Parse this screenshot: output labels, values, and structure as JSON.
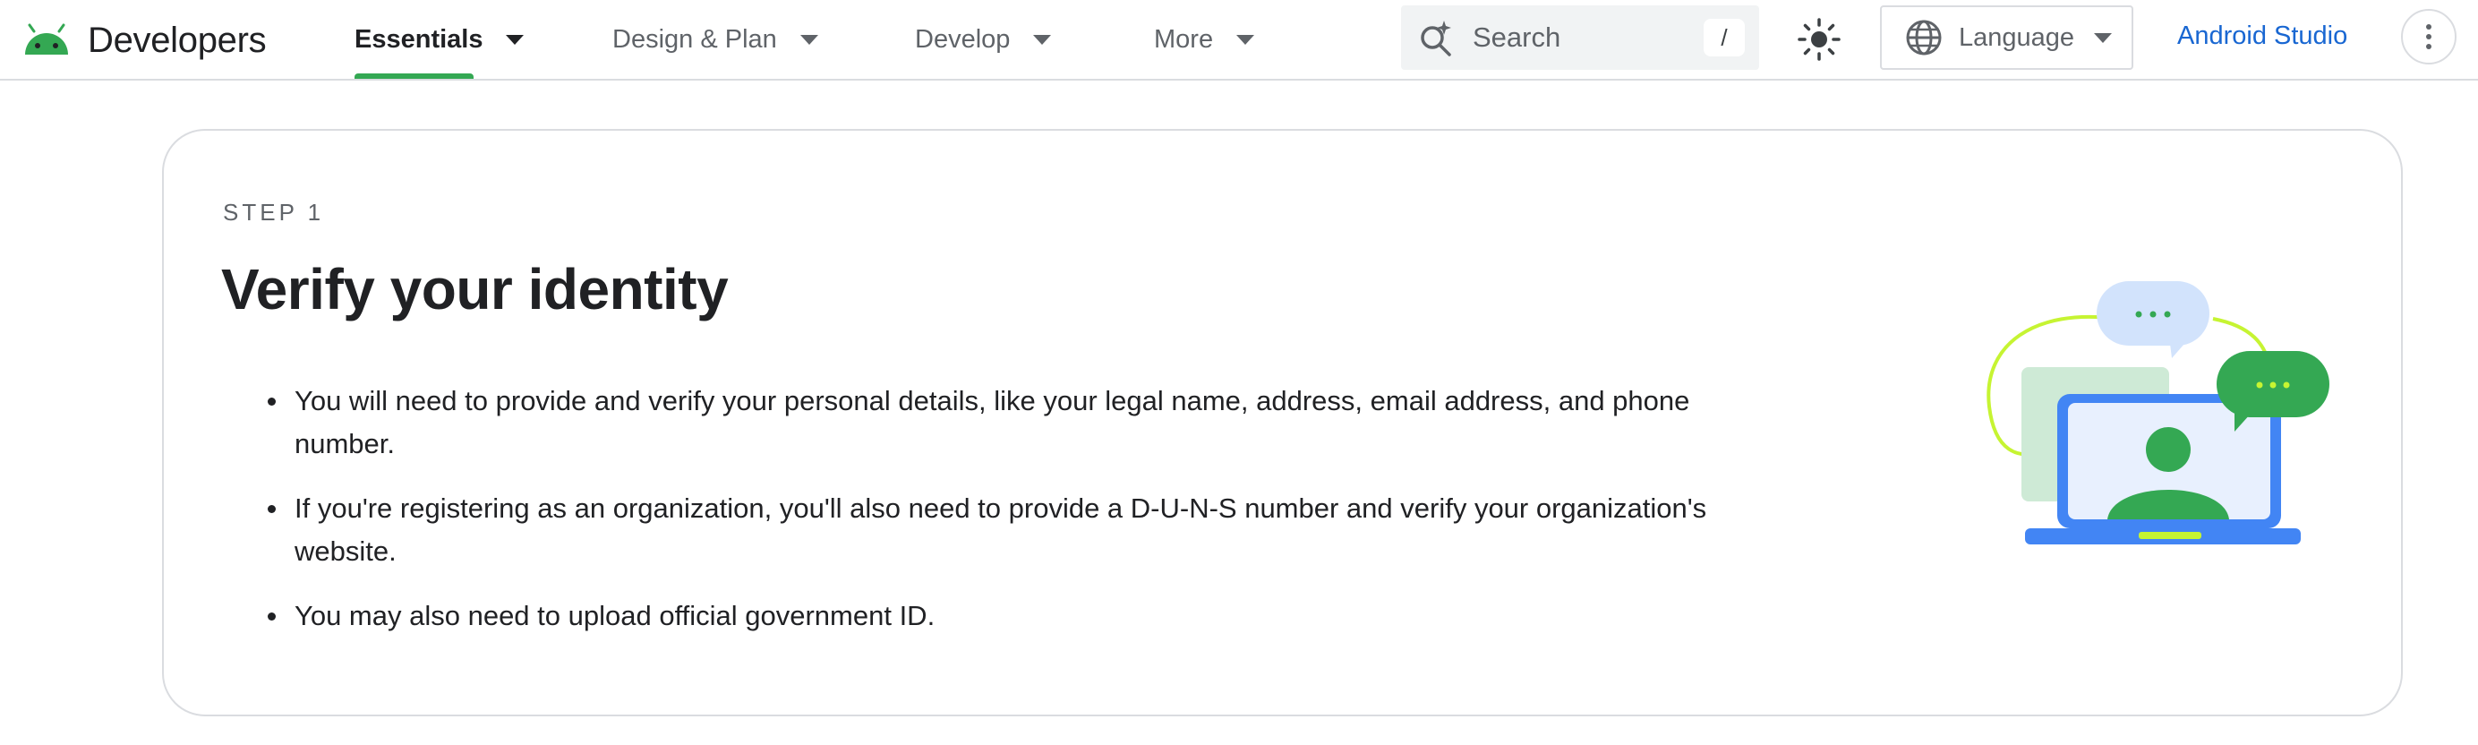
{
  "brand": {
    "name": "Developers",
    "logo_icon": "android-head-icon"
  },
  "nav": {
    "items": [
      {
        "label": "Essentials",
        "active": true
      },
      {
        "label": "Design & Plan",
        "active": false
      },
      {
        "label": "Develop",
        "active": false
      },
      {
        "label": "More",
        "active": false
      }
    ]
  },
  "search": {
    "placeholder": "Search",
    "shortcut": "/",
    "icon": "search-spark-icon"
  },
  "theme_toggle": {
    "icon": "sun-icon"
  },
  "language": {
    "label": "Language",
    "icon": "globe-icon"
  },
  "studio_link": {
    "label": "Android Studio"
  },
  "more_menu": {
    "icon": "more-vert-icon"
  },
  "step": {
    "label": "STEP 1",
    "title": "Verify your identity",
    "bullets": [
      "You will need to provide and verify your personal details, like your legal name, address, email address, and phone number.",
      "If you're registering as an organization, you'll also need to provide a D-U-N-S number and verify your organization's website.",
      "You may also need to upload official government ID."
    ],
    "illustration": "laptop-video-chat-illustration"
  },
  "colors": {
    "accent_green": "#34a853",
    "link_blue": "#1a73e8",
    "laptop_blue": "#4285f4",
    "screen_bg": "#e8f0fe",
    "bubble_blue": "#d2e3fc",
    "lime": "#c6f432",
    "border": "#dadce0"
  }
}
